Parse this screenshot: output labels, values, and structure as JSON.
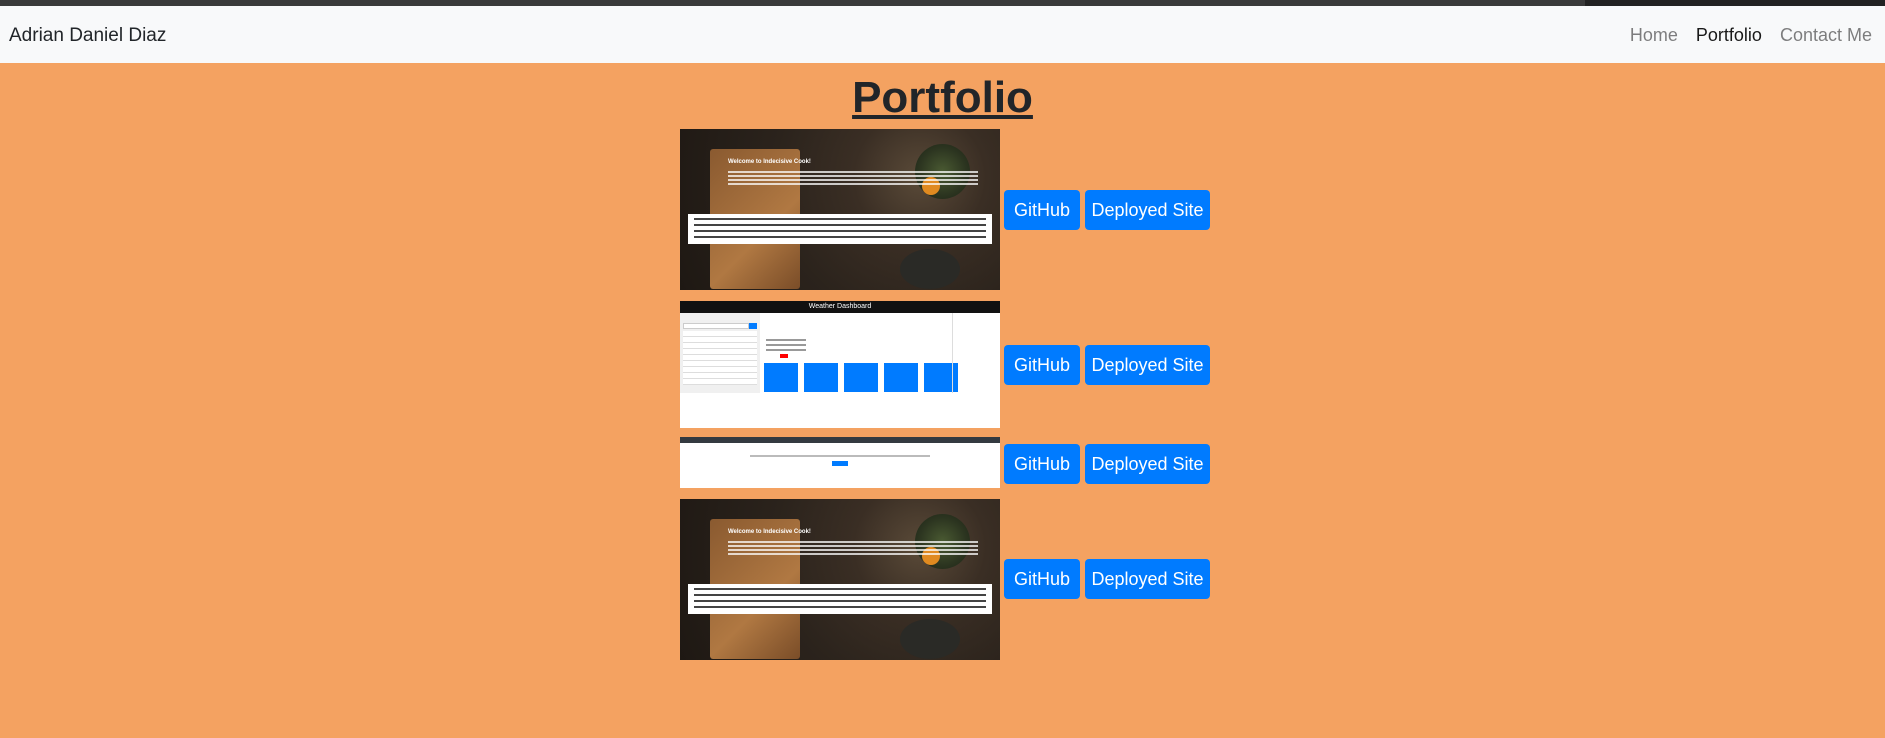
{
  "navbar": {
    "brand": "Adrian Daniel Diaz",
    "links": [
      {
        "label": "Home",
        "active": false
      },
      {
        "label": "Portfolio",
        "active": true
      },
      {
        "label": "Contact Me",
        "active": false
      }
    ]
  },
  "page": {
    "title": "Portfolio",
    "background_color": "#f4a261",
    "button_color": "#007bff"
  },
  "projects": [
    {
      "thumbnail": "Welcome to Indecisive Cook!",
      "github_label": "GitHub",
      "site_label": "Deployed Site"
    },
    {
      "thumbnail": "Weather Dashboard",
      "github_label": "GitHub",
      "site_label": "Deployed Site"
    },
    {
      "thumbnail": "",
      "github_label": "GitHub",
      "site_label": "Deployed Site"
    },
    {
      "thumbnail": "Welcome to Indecisive Cook!",
      "github_label": "GitHub",
      "site_label": "Deployed Site"
    }
  ]
}
